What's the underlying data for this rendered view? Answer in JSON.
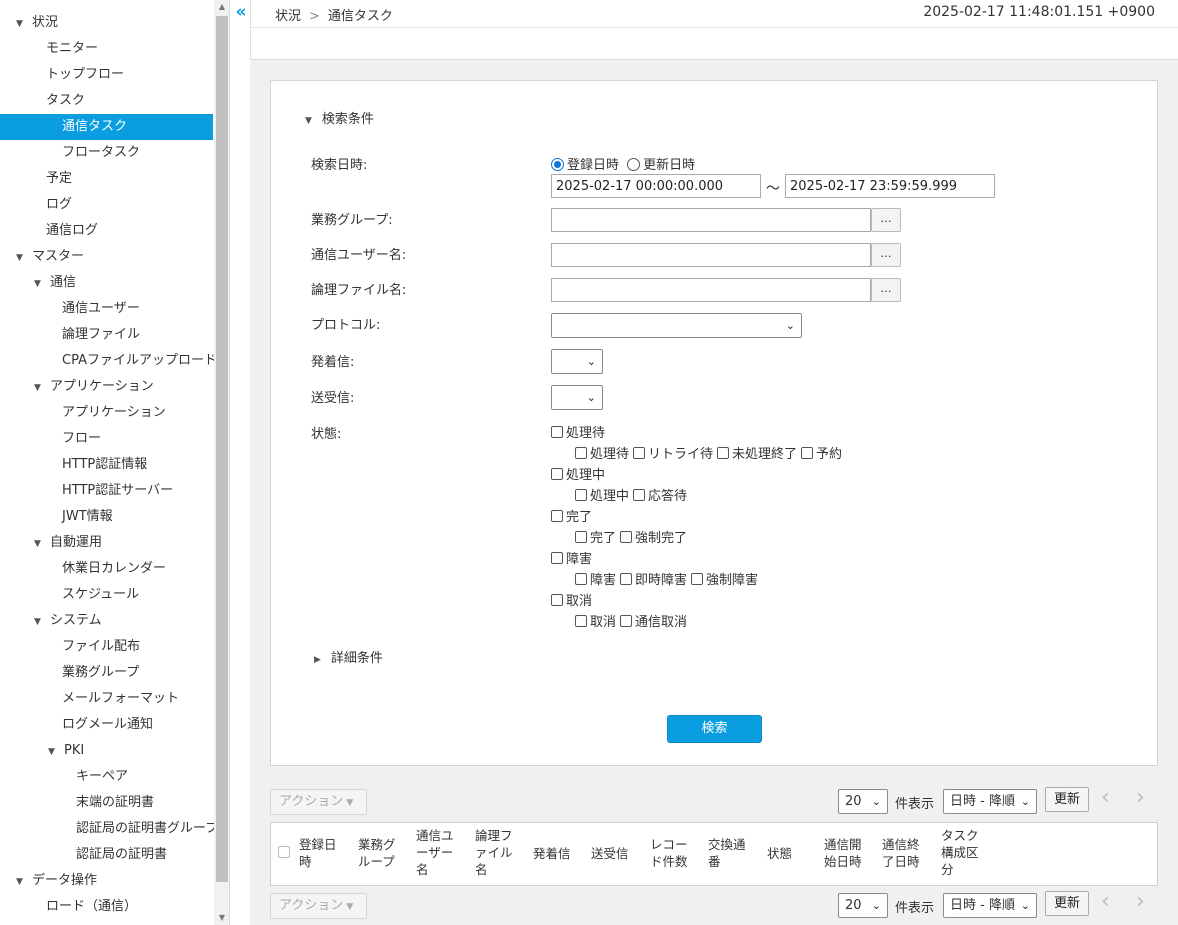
{
  "sidebar": {
    "items": [
      {
        "label": "状況",
        "level": 0,
        "expanded": true
      },
      {
        "label": "モニター",
        "level": 1
      },
      {
        "label": "トップフロー",
        "level": 1
      },
      {
        "label": "タスク",
        "level": 1
      },
      {
        "label": "通信タスク",
        "level": 2,
        "active": true
      },
      {
        "label": "フロータスク",
        "level": 2
      },
      {
        "label": "予定",
        "level": 1
      },
      {
        "label": "ログ",
        "level": 1
      },
      {
        "label": "通信ログ",
        "level": 1
      },
      {
        "label": "マスター",
        "level": 0,
        "expanded": true
      },
      {
        "label": "通信",
        "level": 1,
        "expanded": true
      },
      {
        "label": "通信ユーザー",
        "level": 2
      },
      {
        "label": "論理ファイル",
        "level": 2
      },
      {
        "label": "CPAファイルアップロード",
        "level": 2
      },
      {
        "label": "アプリケーション",
        "level": 1,
        "expanded": true
      },
      {
        "label": "アプリケーション",
        "level": 2
      },
      {
        "label": "フロー",
        "level": 2
      },
      {
        "label": "HTTP認証情報",
        "level": 2
      },
      {
        "label": "HTTP認証サーバー",
        "level": 2
      },
      {
        "label": "JWT情報",
        "level": 2
      },
      {
        "label": "自動運用",
        "level": 1,
        "expanded": true
      },
      {
        "label": "休業日カレンダー",
        "level": 2
      },
      {
        "label": "スケジュール",
        "level": 2
      },
      {
        "label": "システム",
        "level": 1,
        "expanded": true
      },
      {
        "label": "ファイル配布",
        "level": 2
      },
      {
        "label": "業務グループ",
        "level": 2
      },
      {
        "label": "メールフォーマット",
        "level": 2
      },
      {
        "label": "ログメール通知",
        "level": 2
      },
      {
        "label": "PKI",
        "level": 2,
        "expanded": true
      },
      {
        "label": "キーペア",
        "level": 3
      },
      {
        "label": "末端の証明書",
        "level": 3
      },
      {
        "label": "認証局の証明書グループ",
        "level": 3
      },
      {
        "label": "認証局の証明書",
        "level": 3
      },
      {
        "label": "データ操作",
        "level": 0,
        "expanded": true
      },
      {
        "label": "ロード（通信）",
        "level": 1
      }
    ]
  },
  "header": {
    "collapse_icon": "«",
    "breadcrumb": [
      "状況",
      "通信タスク"
    ],
    "breadcrumb_sep": ">",
    "timestamp": "2025-02-17 11:48:01.151 +0900"
  },
  "search": {
    "section_title": "検索条件",
    "date_label": "検索日時:",
    "radio_registered": "登録日時",
    "radio_updated": "更新日時",
    "date_from": "2025-02-17 00:00:00.000",
    "date_tilde": "～",
    "date_to": "2025-02-17 23:59:59.999",
    "group_label": "業務グループ:",
    "user_label": "通信ユーザー名:",
    "file_label": "論理ファイル名:",
    "ellipsis": "…",
    "protocol_label": "プロトコル:",
    "direction_label": "発着信:",
    "sendrecv_label": "送受信:",
    "status_label": "状態:",
    "status_groups": [
      {
        "label": "処理待",
        "children": [
          "処理待",
          "リトライ待",
          "未処理終了",
          "予約"
        ]
      },
      {
        "label": "処理中",
        "children": [
          "処理中",
          "応答待"
        ]
      },
      {
        "label": "完了",
        "children": [
          "完了",
          "強制完了"
        ]
      },
      {
        "label": "障害",
        "children": [
          "障害",
          "即時障害",
          "強制障害"
        ]
      },
      {
        "label": "取消",
        "children": [
          "取消",
          "通信取消"
        ]
      }
    ],
    "detail_title": "詳細条件",
    "search_button": "検索"
  },
  "toolbar": {
    "action_label": "アクション",
    "page_size": "20",
    "page_size_label": "件表示",
    "sort": "日時 - 降順",
    "refresh": "更新",
    "prev": "‹",
    "next": "›"
  },
  "table": {
    "columns": [
      [
        "登録日",
        "時"
      ],
      [
        "業務グ",
        "ループ"
      ],
      [
        "通信ユ",
        "ーザー",
        "名"
      ],
      [
        "論理フ",
        "ァイル",
        "名"
      ],
      [
        "発着信"
      ],
      [
        "送受信"
      ],
      [
        "レコー",
        "ド件数"
      ],
      [
        "交換通",
        "番"
      ],
      [
        "状態"
      ],
      [
        "通信開",
        "始日時"
      ],
      [
        "通信終",
        "了日時"
      ],
      [
        "タスク",
        "構成区",
        "分"
      ]
    ]
  },
  "colors": {
    "accent": "#0a9ee0"
  }
}
